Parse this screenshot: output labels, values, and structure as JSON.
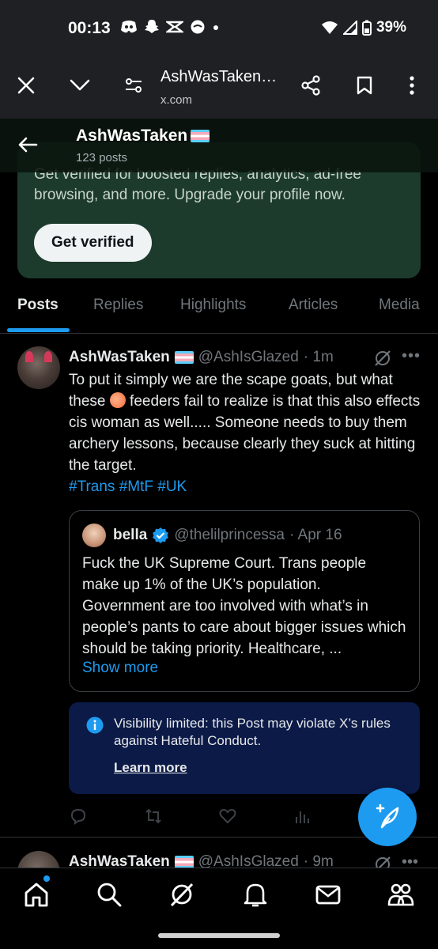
{
  "status_bar": {
    "time": "00:13",
    "battery": "39%",
    "icons": [
      "discord-icon",
      "snapchat-icon",
      "capcut-icon",
      "chat-icon",
      "dot-icon",
      "wifi-icon",
      "signal-icon",
      "battery-icon"
    ]
  },
  "browser": {
    "title": "AshWasTaken…",
    "url": "x.com"
  },
  "profile": {
    "name": "AshWasTaken",
    "posts_count": "123 posts"
  },
  "verified_card": {
    "text_line1": "Get verified for boosted replies, analytics, ad-free",
    "text_line2": "browsing, and more. Upgrade your profile now.",
    "button": "Get verified"
  },
  "tabs": [
    {
      "label": "Posts",
      "active": true
    },
    {
      "label": "Replies",
      "active": false
    },
    {
      "label": "Highlights",
      "active": false
    },
    {
      "label": "Articles",
      "active": false
    },
    {
      "label": "Media",
      "active": false
    }
  ],
  "tweet": {
    "name": "AshWasTaken",
    "handle": "@AshIsGlazed",
    "time": "· 1m",
    "text_before_emoji": "To put it simply we are the scape goats, but what these ",
    "text_after_emoji": " feeders fail to realize is that this also effects cis woman as well..... Someone needs to buy them archery lessons, because clearly they suck at hitting the target.",
    "hashtags": "#Trans #MtF #UK",
    "quote": {
      "name": "bella",
      "handle": "@thelilprincessa",
      "time": "· Apr 16",
      "text": "Fuck the UK Supreme Court. Trans people make up 1% of the UK’s population. Government are too involved with what’s in people’s pants to care about bigger issues which should be taking priority. Healthcare, ...",
      "show_more": "Show more"
    },
    "notice": {
      "text": "Visibility limited: this Post may violate X’s rules against Hateful Conduct.",
      "link": "Learn more"
    }
  },
  "next_tweet": {
    "name": "AshWasTaken",
    "handle": "@AshIsGlazed",
    "time": "· 9m"
  },
  "colors": {
    "accent": "#1d9bf0",
    "verified_card_bg": "#1d3b2c",
    "notice_bg": "#0b1a47"
  }
}
